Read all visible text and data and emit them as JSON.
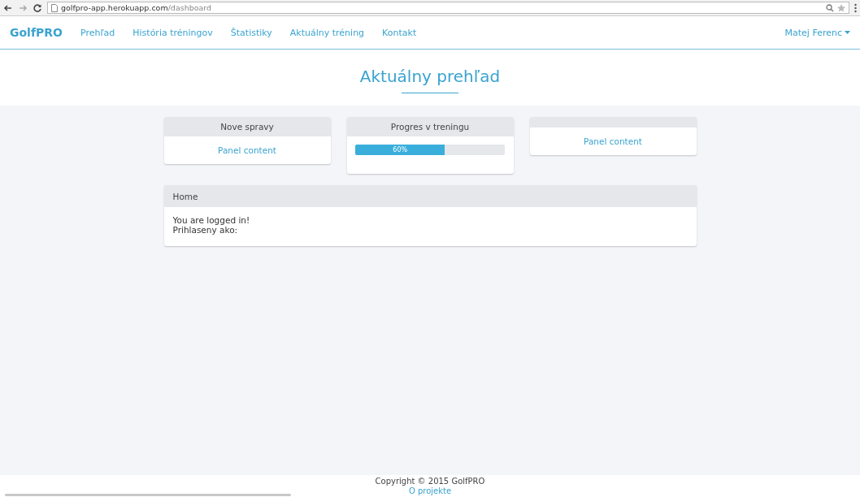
{
  "browser": {
    "url_host": "golfpro-app.herokuapp.com",
    "url_path": "/dashboard"
  },
  "nav": {
    "brand": "GolfPRO",
    "items": [
      "Prehľad",
      "História tréningov",
      "Štatistiky",
      "Aktuálny tréning",
      "Kontakt"
    ],
    "user": "Matej Ferenc"
  },
  "page_title": "Aktuálny prehľad",
  "panels": [
    {
      "kind": "text",
      "title": "Nove spravy",
      "content": "Panel content"
    },
    {
      "kind": "progress",
      "title": "Progres v treningu",
      "level": 0.6,
      "label": "60%"
    },
    {
      "kind": "text",
      "content": "Panel content"
    }
  ],
  "home": {
    "title": "Home",
    "lines": [
      "You are logged in!",
      "Prihlaseny ako:"
    ]
  },
  "footer": {
    "copyright": "Copyright © 2015 GolfPRO",
    "link": "O projekte"
  }
}
